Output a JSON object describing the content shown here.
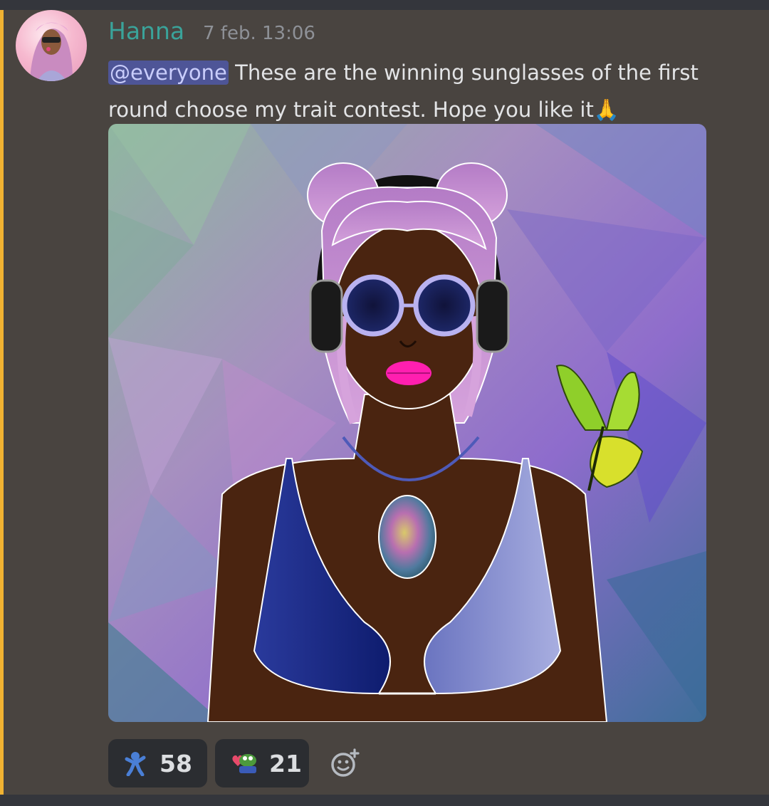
{
  "message": {
    "author": "Hanna",
    "timestamp": "7 feb. 13:06",
    "mention": "@everyone",
    "text_line1": " These are the winning sunglasses of the first",
    "text_line2": "round choose my trait contest. Hope you like it",
    "emoji": "🙏"
  },
  "attachment": {
    "type": "image",
    "subject": "illustrated portrait with purple hair, headphones, round sunglasses, pendant necklace and a yellow-green butterfly"
  },
  "reactions": [
    {
      "emoji_name": "blue-dancing-character-icon",
      "count": "58"
    },
    {
      "emoji_name": "pepe-frog-heart-icon",
      "count": "21"
    }
  ],
  "add_reaction": {
    "icon": "add-reaction-smiley-icon"
  },
  "colors": {
    "background": "#494440",
    "mention_bar": "#f0b232",
    "username": "#3aa39a",
    "mention_bg": "#4e5597",
    "reaction_bg": "#2b2d31"
  }
}
